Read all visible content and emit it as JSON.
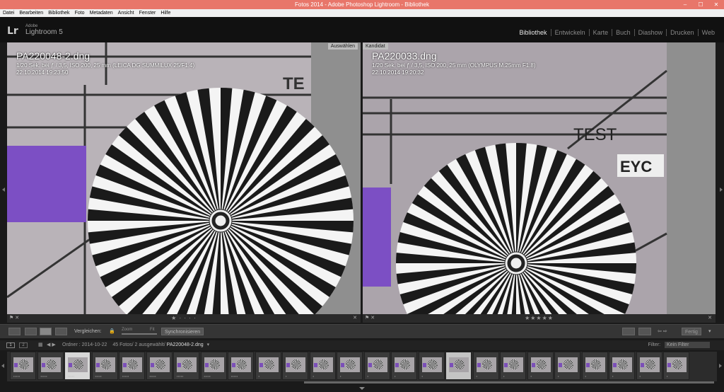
{
  "window": {
    "title": "Fotos 2014 - Adobe Photoshop Lightroom - Bibliothek",
    "buttons": [
      "–",
      "☐",
      "✕"
    ]
  },
  "menu": [
    "Datei",
    "Bearbeiten",
    "Bibliothek",
    "Foto",
    "Metadaten",
    "Ansicht",
    "Fenster",
    "Hilfe"
  ],
  "identity": {
    "logo": "Lr",
    "adobe": "Adobe",
    "name": "Lightroom 5"
  },
  "modules": [
    "Bibliothek",
    "Entwickeln",
    "Karte",
    "Buch",
    "Diashow",
    "Drucken",
    "Web"
  ],
  "active_module": "Bibliothek",
  "left_pane": {
    "tag": "Auswählen",
    "filename": "PA220048-2.dng",
    "exposure": "1/20 Sek. bei ƒ / 3,5, ISO 200, 25 mm (LEICA DG SUMMILUX 25/F1.4)",
    "datetime": "22.10.2014 19:23:50",
    "rating": "★ · · · ·"
  },
  "right_pane": {
    "tag": "Kandidat",
    "filename": "PA220033.dng",
    "exposure": "1/20 Sek. bei ƒ / 3,5, ISO 200, 25 mm (OLYMPUS M.25mm F1.8)",
    "datetime": "22.10.2014 19:20:32",
    "rating": "★★★★★"
  },
  "photo_text": {
    "test": "TEST",
    "eyc": "EYC",
    "te": "TE"
  },
  "toolbar": {
    "compare_label": "Vergleichen:",
    "zoom_label": "Zoom",
    "fit_label": "Fit",
    "sync_label": "Synchronisieren",
    "done_label": "Fertig"
  },
  "filmbar": {
    "folder": "Ordner : 2014-10-22",
    "count": "45 Fotos/ 2 ausgewählt/",
    "current": "PA220048-2.dng",
    "filter_label": "Filter:",
    "filter_value": "Kein Filter",
    "page1": "1",
    "page2": "2"
  },
  "thumbnails": [
    {
      "stars": "•••••"
    },
    {
      "stars": "•••••"
    },
    {
      "stars": "•••••",
      "state": "selected"
    },
    {
      "stars": "•••••"
    },
    {
      "stars": "•••••"
    },
    {
      "stars": "•••••"
    },
    {
      "stars": "•••••"
    },
    {
      "stars": "•••••"
    },
    {
      "stars": "•••••"
    },
    {
      "stars": "•"
    },
    {
      "stars": "•"
    },
    {
      "stars": "•"
    },
    {
      "stars": "•"
    },
    {
      "stars": "•"
    },
    {
      "stars": "•"
    },
    {
      "stars": "•"
    },
    {
      "stars": "•",
      "state": "candidate"
    },
    {
      "stars": "•"
    },
    {
      "stars": "•"
    },
    {
      "stars": "•"
    },
    {
      "stars": "•"
    },
    {
      "stars": "•"
    },
    {
      "stars": "•"
    },
    {
      "stars": "•"
    },
    {
      "stars": "•"
    }
  ]
}
